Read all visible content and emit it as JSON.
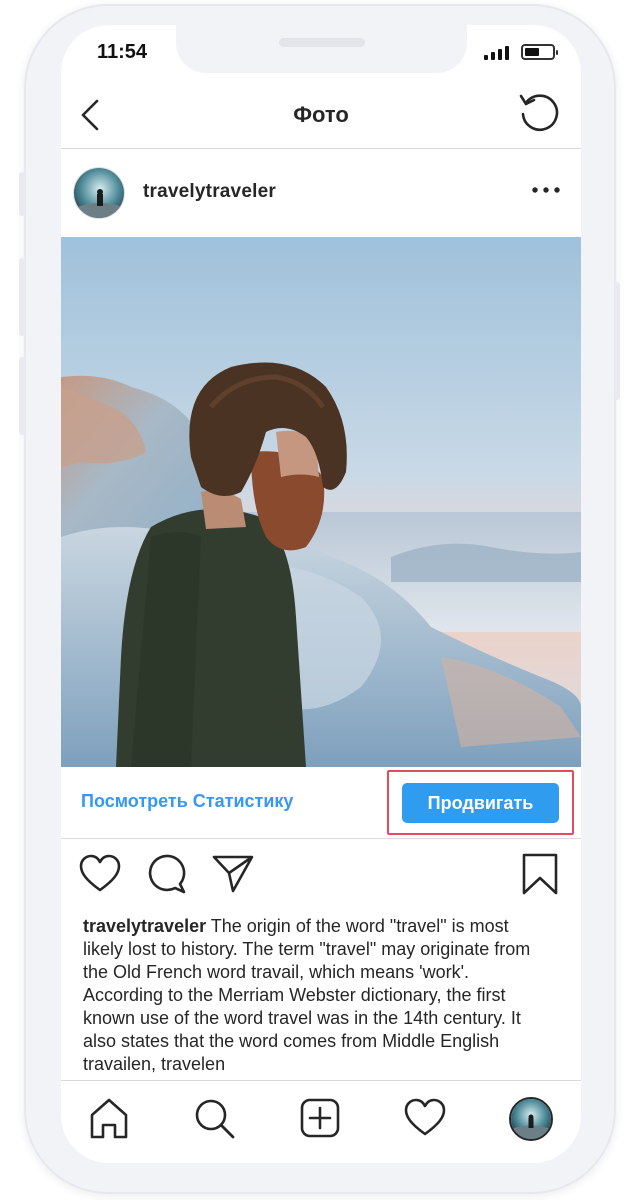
{
  "status_bar": {
    "time": "11:54"
  },
  "header": {
    "title": "Фото"
  },
  "post": {
    "username": "travelytraveler",
    "stats_link": "Посмотреть Статистику",
    "promote_label": "Продвигать",
    "caption_username": "travelytraveler",
    "caption_text": " The origin of the word \"travel\" is most likely lost to history. The term \"travel\" may originate from the Old French word travail, which means 'work'. According to the Merriam Webster dictionary, the first known use of the word travel was in the 14th century. It also states that the word comes from Middle English travailen, travelen"
  },
  "icons": {
    "header": [
      "back-icon",
      "refresh-icon"
    ],
    "post": [
      "more-icon",
      "heart-icon",
      "comment-icon",
      "share-icon",
      "bookmark-icon"
    ],
    "tab_bar": [
      "home-icon",
      "search-icon",
      "add-post-icon",
      "activity-heart-icon",
      "profile-avatar"
    ]
  },
  "colors": {
    "accent_blue": "#3897f0",
    "button_blue": "#2f9cf0",
    "highlight_red": "#e04e5c",
    "text_dark": "#262626",
    "divider": "#dbdbdb"
  }
}
